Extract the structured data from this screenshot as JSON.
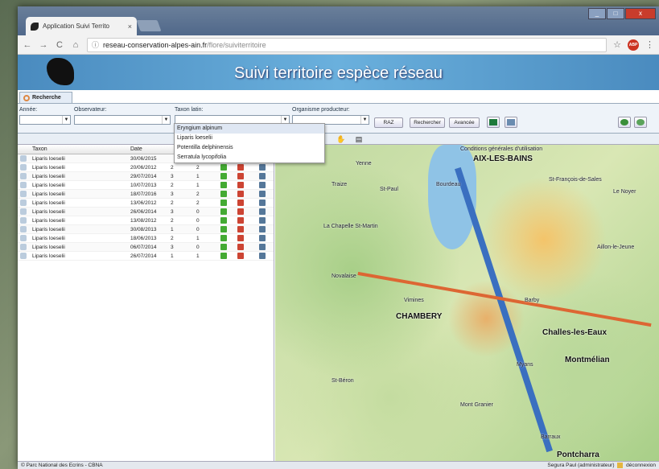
{
  "browser": {
    "tab_title": "Application Suivi Territo",
    "tab_close": "×",
    "url_host": "reseau-conservation-alpes-ain.fr",
    "url_path": "/flore/suiviterritoire",
    "win_min": "_",
    "win_max": "□",
    "win_close": "x"
  },
  "banner": {
    "title": "Suivi territoire espèce réseau"
  },
  "search_tab": {
    "label": "Recherche"
  },
  "filters": {
    "annee_label": "Année:",
    "observateur_label": "Observateur:",
    "taxon_label": "Taxon latin:",
    "organisme_label": "Organisme producteur:",
    "raz_label": "RAZ",
    "rechercher_label": "Rechercher",
    "avancee_label": "Avancée"
  },
  "taxon_dropdown": {
    "options": [
      "Eryngium alpinum",
      "Liparis loeselii",
      "Potentilla delphinensis",
      "Serratula lycopifolia"
    ],
    "highlighted": 0
  },
  "table": {
    "headers": {
      "taxon": "Taxon",
      "date": "Date"
    },
    "rows": [
      {
        "taxon": "Liparis loeselii",
        "date": "30/06/2015",
        "a": "",
        "b": ""
      },
      {
        "taxon": "Liparis loeselii",
        "date": "20/06/2012",
        "a": "2",
        "b": "2"
      },
      {
        "taxon": "Liparis loeselii",
        "date": "29/07/2014",
        "a": "3",
        "b": "1"
      },
      {
        "taxon": "Liparis loeselii",
        "date": "10/07/2013",
        "a": "2",
        "b": "1"
      },
      {
        "taxon": "Liparis loeselii",
        "date": "18/07/2016",
        "a": "3",
        "b": "2"
      },
      {
        "taxon": "Liparis loeselii",
        "date": "13/06/2012",
        "a": "2",
        "b": "2"
      },
      {
        "taxon": "Liparis loeselii",
        "date": "26/06/2014",
        "a": "3",
        "b": "0"
      },
      {
        "taxon": "Liparis loeselii",
        "date": "13/08/2012",
        "a": "2",
        "b": "0"
      },
      {
        "taxon": "Liparis loeselii",
        "date": "30/08/2013",
        "a": "1",
        "b": "0"
      },
      {
        "taxon": "Liparis loeselii",
        "date": "18/06/2013",
        "a": "2",
        "b": "1"
      },
      {
        "taxon": "Liparis loeselii",
        "date": "06/07/2014",
        "a": "3",
        "b": "0"
      },
      {
        "taxon": "Liparis loeselii",
        "date": "26/07/2014",
        "a": "1",
        "b": "1"
      }
    ]
  },
  "map": {
    "towns": [
      "AIX-LES-BAINS",
      "CHAMBERY",
      "Challes-les-Eaux",
      "Montmélian",
      "Pontcharra"
    ],
    "places": [
      "Yenne",
      "Traize",
      "St-Paul",
      "Bourdeau",
      "La Chapelle St-Martin",
      "Novalaise",
      "Vimines",
      "Myans",
      "Barby",
      "Le Noyer",
      "St-François-de-Sales",
      "Aillon-le-Jeune",
      "Barraux",
      "St-Béron",
      "Mont Granier"
    ],
    "attribution": "Conditions générales d'utilisation"
  },
  "status": {
    "left": "© Parc National des Ecrins - CBNA",
    "right": "Segura Paul (administrateur)",
    "logout": "déconnexion"
  }
}
